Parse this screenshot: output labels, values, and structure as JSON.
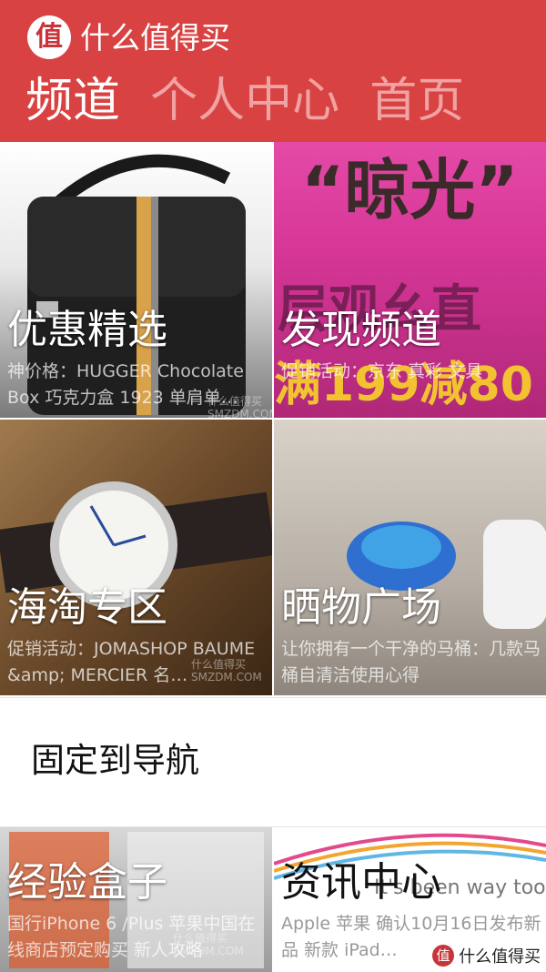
{
  "app": {
    "logo_char": "值",
    "title": "什么值得买"
  },
  "pivot": {
    "items": [
      "频道",
      "个人中心",
      "首页"
    ],
    "active_index": 0
  },
  "tiles": [
    {
      "title": "优惠精选",
      "desc": "神价格：HUGGER Chocolate Box 巧克力盒 1923 单肩单…"
    },
    {
      "title": "发现频道",
      "desc": "促销活动：京东 真彩 文具"
    },
    {
      "title": "海淘专区",
      "desc": "促销活动：JOMASHOP BAUME &amp; MERCIER 名…"
    },
    {
      "title": "晒物广场",
      "desc": "让你拥有一个干净的马桶：几款马桶自清洁使用心得"
    },
    {
      "title": "经验盒子",
      "desc": "国行iPhone 6 /Plus 苹果中国在线商店预定购买 新人攻略"
    },
    {
      "title": "资讯中心",
      "desc": "Apple 苹果 确认10月16日发布新品 新款 iPad…"
    }
  ],
  "tile_images": {
    "t2_banner_top": "“晾光”",
    "t2_banner_mid": "层观幺直",
    "t2_banner_bottom": "满199减80",
    "t6_bg_text": "It's been way too long."
  },
  "watermark": {
    "site": "什么值得买",
    "domain": "SMZDM.COM"
  },
  "context_menu": {
    "pin_label": "固定到导航"
  },
  "colors": {
    "header": "#d94242",
    "pivot_active": "#ffffff",
    "pivot_inactive": "#f0a3a3",
    "t2_bg": "#d63697"
  }
}
